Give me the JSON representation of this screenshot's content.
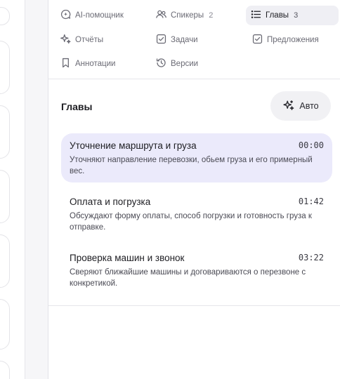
{
  "tabs": [
    {
      "label": "AI-помощник",
      "count": "",
      "icon": "ai-assistant-icon",
      "active": false
    },
    {
      "label": "Спикеры",
      "count": "2",
      "icon": "speakers-icon",
      "active": false
    },
    {
      "label": "Главы",
      "count": "3",
      "icon": "list-icon",
      "active": true
    },
    {
      "label": "Отчёты",
      "count": "",
      "icon": "sparkle-icon",
      "active": false
    },
    {
      "label": "Задачи",
      "count": "",
      "icon": "checkbox-icon",
      "active": false
    },
    {
      "label": "Предложения",
      "count": "",
      "icon": "checkbox-icon",
      "active": false
    },
    {
      "label": "Аннотации",
      "count": "",
      "icon": "bookmark-icon",
      "active": false
    },
    {
      "label": "Версии",
      "count": "",
      "icon": "history-icon",
      "active": false
    }
  ],
  "chapters_section": {
    "title": "Главы",
    "auto_button_label": "Авто",
    "items": [
      {
        "title": "Уточнение маршрута и груза",
        "time": "00:00",
        "description": "Уточняют направление перевозки, обьем груза и его примерный вес.",
        "active": true
      },
      {
        "title": "Оплата и погрузка",
        "time": "01:42",
        "description": "Обсуждают форму оплаты, способ погрузки и готовность груза к отправке.",
        "active": false
      },
      {
        "title": "Проверка машин и звонок",
        "time": "03:22",
        "description": "Сверяют ближайшие машины и договариваются о перезвоне с конкретикой.",
        "active": false
      }
    ]
  },
  "colors": {
    "active_chapter_bg": "#ebeafb",
    "active_tab_bg": "#efeff4"
  }
}
